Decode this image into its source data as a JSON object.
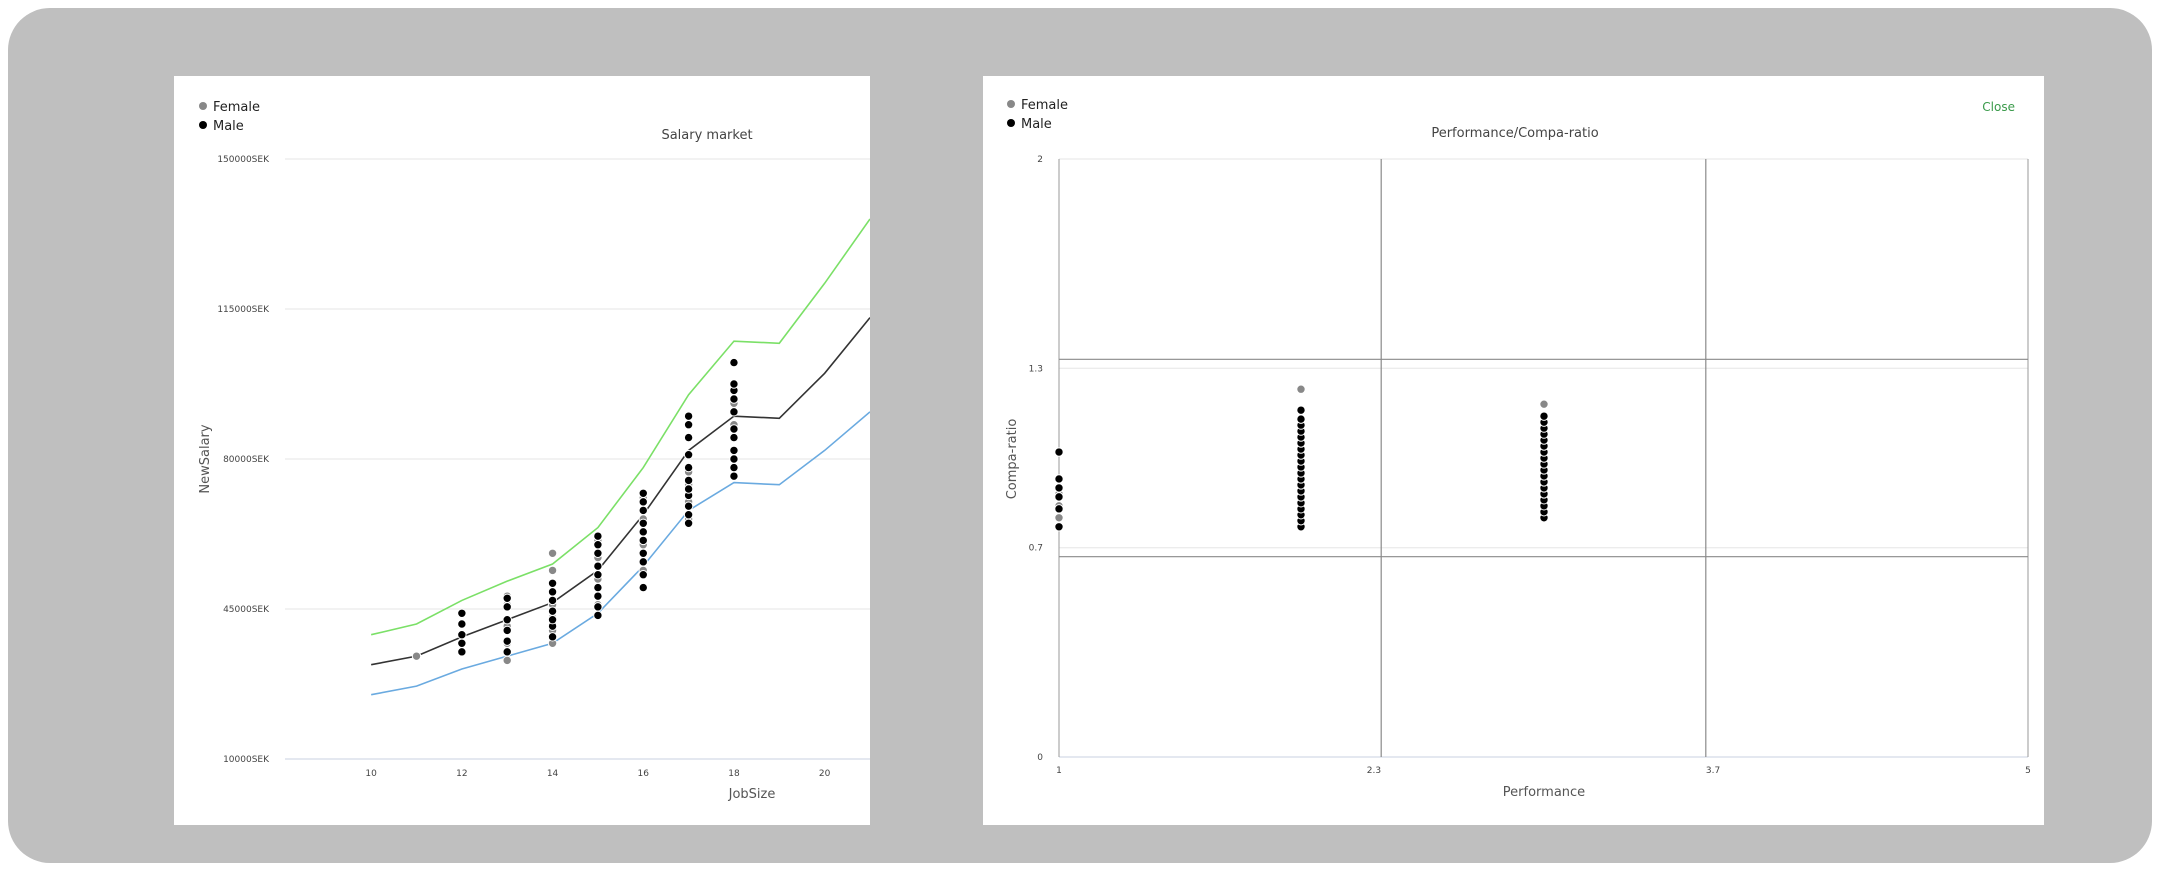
{
  "colors": {
    "frame": "#bfbfbf",
    "female_dot": "#888888",
    "male_dot": "#000000",
    "upper_line": "#7be067",
    "mid_line": "#333333",
    "lower_line": "#6aaae0",
    "close_link": "#3a9a4a"
  },
  "close_label": "Close",
  "chart_data": [
    {
      "type": "scatter",
      "title": "Salary market",
      "xlabel": "JobSize",
      "ylabel": "NewSalary",
      "legend": [
        "Female",
        "Male"
      ],
      "legend_position": "top-left",
      "xlim": [
        8.1,
        21.0
      ],
      "ylim": [
        10000,
        150000
      ],
      "x_ticks": [
        "10",
        "12",
        "14",
        "16",
        "18",
        "20"
      ],
      "y_ticks": [
        "10000SEK",
        "45000SEK",
        "80000SEK",
        "115000SEK",
        "150000SEK"
      ],
      "grid": "horizontal",
      "lines": [
        {
          "name": "upper",
          "x": [
            10,
            11,
            12,
            13,
            14,
            15,
            16,
            17,
            18,
            19,
            20,
            21
          ],
          "y": [
            39000,
            41500,
            47000,
            51500,
            55500,
            64000,
            78000,
            95000,
            107500,
            107000,
            121000,
            136000
          ]
        },
        {
          "name": "mid",
          "x": [
            10,
            11,
            12,
            13,
            14,
            15,
            16,
            17,
            18,
            19,
            20,
            21
          ],
          "y": [
            32000,
            34000,
            38500,
            42500,
            46500,
            54000,
            67000,
            82000,
            90000,
            89500,
            100000,
            113000
          ]
        },
        {
          "name": "lower",
          "x": [
            10,
            11,
            12,
            13,
            14,
            15,
            16,
            17,
            18,
            19,
            20,
            21
          ],
          "y": [
            25000,
            27000,
            31000,
            34000,
            37000,
            44000,
            55000,
            68000,
            74500,
            74000,
            82000,
            91000
          ]
        }
      ],
      "series": [
        {
          "name": "Female",
          "points": [
            [
              11,
              34000
            ],
            [
              13,
              33000
            ],
            [
              13,
              37000
            ],
            [
              13,
              41000
            ],
            [
              13,
              46000
            ],
            [
              13,
              48000
            ],
            [
              14,
              37000
            ],
            [
              14,
              40000
            ],
            [
              14,
              43000
            ],
            [
              14,
              46000
            ],
            [
              14,
              49000
            ],
            [
              14,
              54000
            ],
            [
              14,
              58000
            ],
            [
              15,
              46000
            ],
            [
              15,
              52000
            ],
            [
              15,
              57000
            ],
            [
              15,
              61000
            ],
            [
              16,
              54000
            ],
            [
              16,
              60000
            ],
            [
              16,
              66000
            ],
            [
              16,
              71000
            ],
            [
              17,
              66000
            ],
            [
              17,
              70000
            ],
            [
              17,
              74000
            ],
            [
              17,
              77000
            ],
            [
              18,
              82000
            ],
            [
              18,
              88000
            ],
            [
              18,
              93000
            ]
          ]
        },
        {
          "name": "Male",
          "points": [
            [
              12,
              35000
            ],
            [
              12,
              37000
            ],
            [
              12,
              39000
            ],
            [
              12,
              41500
            ],
            [
              12,
              44000
            ],
            [
              13,
              35000
            ],
            [
              13,
              37500
            ],
            [
              13,
              40000
            ],
            [
              13,
              42500
            ],
            [
              13,
              45500
            ],
            [
              13,
              47500
            ],
            [
              14,
              38500
            ],
            [
              14,
              41000
            ],
            [
              14,
              42500
            ],
            [
              14,
              44500
            ],
            [
              14,
              47000
            ],
            [
              14,
              49000
            ],
            [
              14,
              51000
            ],
            [
              15,
              43500
            ],
            [
              15,
              45500
            ],
            [
              15,
              48000
            ],
            [
              15,
              50000
            ],
            [
              15,
              53000
            ],
            [
              15,
              55000
            ],
            [
              15,
              58000
            ],
            [
              15,
              60000
            ],
            [
              15,
              62000
            ],
            [
              16,
              50000
            ],
            [
              16,
              53000
            ],
            [
              16,
              56000
            ],
            [
              16,
              58000
            ],
            [
              16,
              61000
            ],
            [
              16,
              63000
            ],
            [
              16,
              65000
            ],
            [
              16,
              68000
            ],
            [
              16,
              70000
            ],
            [
              16,
              72000
            ],
            [
              17,
              65000
            ],
            [
              17,
              67000
            ],
            [
              17,
              69000
            ],
            [
              17,
              71500
            ],
            [
              17,
              73000
            ],
            [
              17,
              75000
            ],
            [
              17,
              78000
            ],
            [
              17,
              81000
            ],
            [
              17,
              85000
            ],
            [
              17,
              88000
            ],
            [
              17,
              90000
            ],
            [
              18,
              76000
            ],
            [
              18,
              78000
            ],
            [
              18,
              80000
            ],
            [
              18,
              82000
            ],
            [
              18,
              85000
            ],
            [
              18,
              87000
            ],
            [
              18,
              91000
            ],
            [
              18,
              94000
            ],
            [
              18,
              96000
            ],
            [
              18,
              97500
            ],
            [
              18,
              102500
            ]
          ]
        }
      ]
    },
    {
      "type": "scatter",
      "title": "Performance/Compa-ratio",
      "xlabel": "Performance",
      "ylabel": "Compa-ratio",
      "legend": [
        "Female",
        "Male"
      ],
      "legend_position": "top-left",
      "xlim": [
        1,
        5
      ],
      "ylim": [
        0,
        2
      ],
      "x_ticks": [
        "1",
        "2.3",
        "3.7",
        "5"
      ],
      "y_ticks": [
        "0",
        "0.7",
        "1.3",
        "2"
      ],
      "grid": "both",
      "reference_lines": {
        "x": [
          2.33,
          3.67
        ],
        "y": [
          0.67,
          1.33
        ]
      },
      "series": [
        {
          "name": "Female",
          "points": [
            [
              1,
              0.84
            ],
            [
              1,
              0.8
            ],
            [
              1,
              0.88
            ],
            [
              2,
              1.23
            ],
            [
              2,
              0.78
            ],
            [
              2,
              0.86
            ],
            [
              2,
              0.94
            ],
            [
              2,
              1.02
            ],
            [
              2,
              1.1
            ],
            [
              3,
              1.18
            ],
            [
              3,
              0.83
            ],
            [
              3,
              0.92
            ],
            [
              3,
              1.0
            ],
            [
              3,
              1.09
            ]
          ]
        },
        {
          "name": "Male",
          "points": [
            [
              1,
              0.77
            ],
            [
              1,
              0.83
            ],
            [
              1,
              0.87
            ],
            [
              1,
              0.9
            ],
            [
              1,
              0.93
            ],
            [
              1,
              1.02
            ],
            [
              2,
              0.77
            ],
            [
              2,
              0.79
            ],
            [
              2,
              0.81
            ],
            [
              2,
              0.83
            ],
            [
              2,
              0.85
            ],
            [
              2,
              0.87
            ],
            [
              2,
              0.89
            ],
            [
              2,
              0.91
            ],
            [
              2,
              0.93
            ],
            [
              2,
              0.95
            ],
            [
              2,
              0.97
            ],
            [
              2,
              0.99
            ],
            [
              2,
              1.01
            ],
            [
              2,
              1.03
            ],
            [
              2,
              1.05
            ],
            [
              2,
              1.07
            ],
            [
              2,
              1.09
            ],
            [
              2,
              1.11
            ],
            [
              2,
              1.13
            ],
            [
              2,
              1.16
            ],
            [
              3,
              0.8
            ],
            [
              3,
              0.82
            ],
            [
              3,
              0.84
            ],
            [
              3,
              0.86
            ],
            [
              3,
              0.88
            ],
            [
              3,
              0.9
            ],
            [
              3,
              0.92
            ],
            [
              3,
              0.94
            ],
            [
              3,
              0.96
            ],
            [
              3,
              0.98
            ],
            [
              3,
              1.0
            ],
            [
              3,
              1.02
            ],
            [
              3,
              1.04
            ],
            [
              3,
              1.06
            ],
            [
              3,
              1.08
            ],
            [
              3,
              1.1
            ],
            [
              3,
              1.12
            ],
            [
              3,
              1.14
            ]
          ]
        }
      ]
    }
  ]
}
